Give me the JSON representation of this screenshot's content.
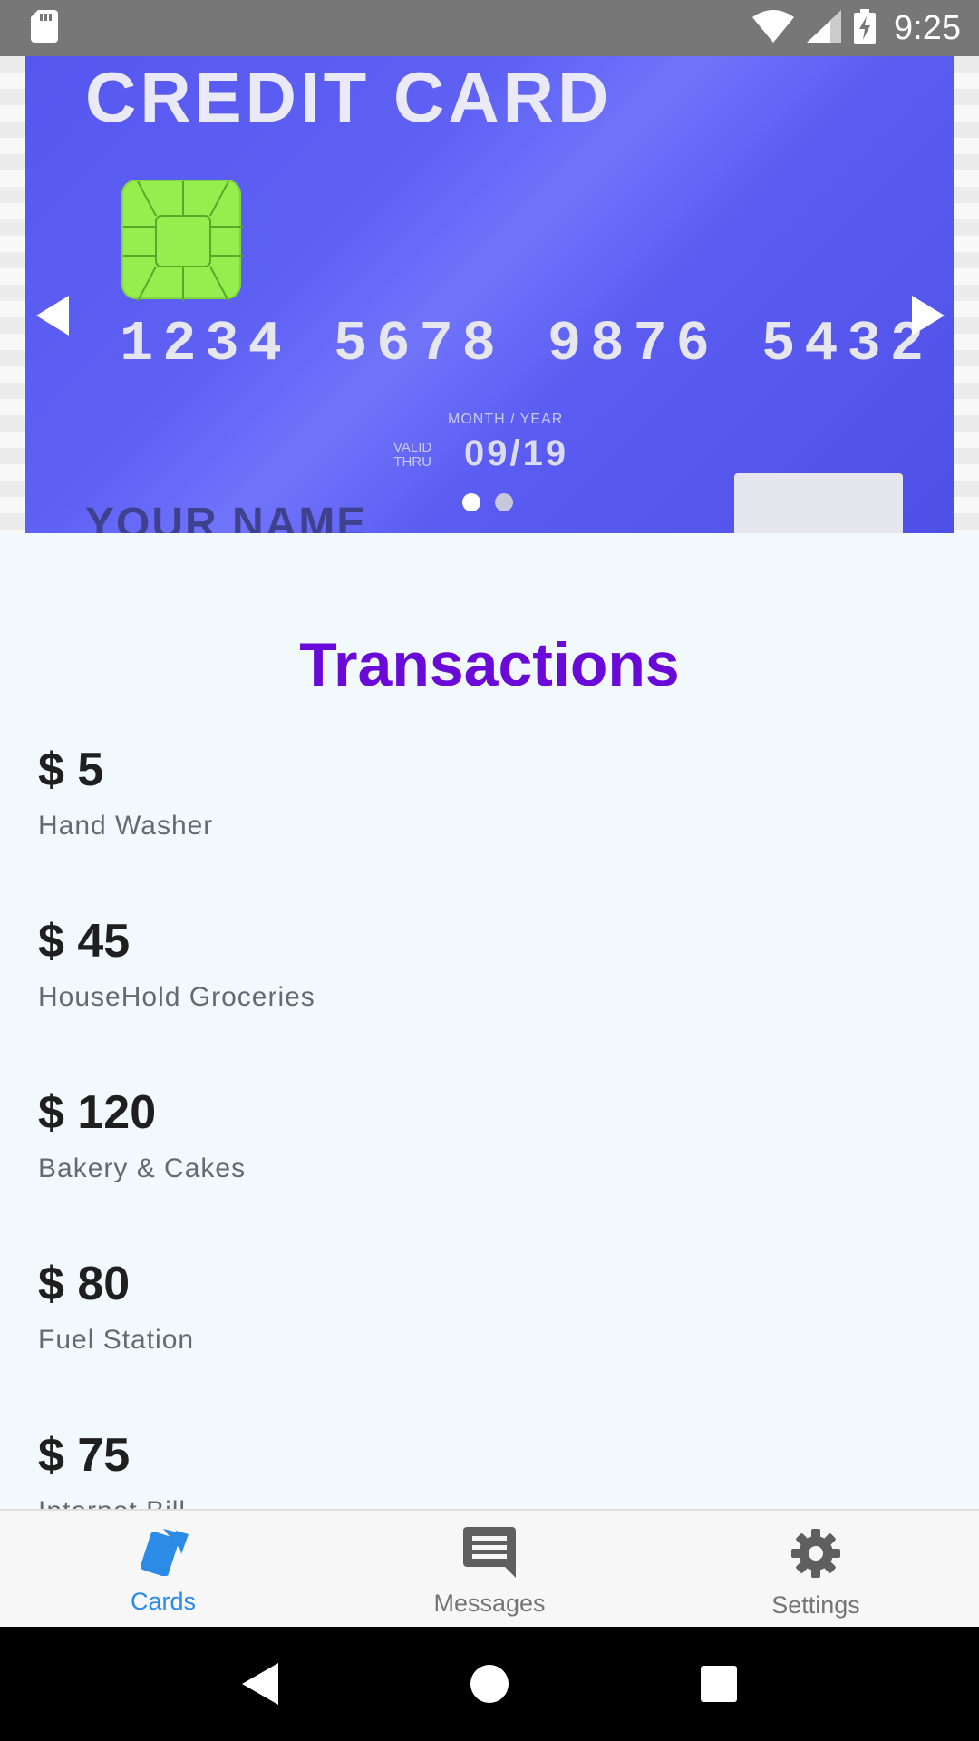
{
  "status_bar": {
    "time": "9:25",
    "icons": [
      "sd-card-icon",
      "wifi-icon",
      "signal-icon",
      "battery-charging-icon"
    ]
  },
  "carousel": {
    "card": {
      "title": "CREDIT CARD",
      "number": "1234 5678 9876 5432",
      "month_year_label": "MONTH / YEAR",
      "valid_line1": "VALID",
      "valid_line2": "THRU",
      "expiry": "09/19",
      "name": "YOUR NAME"
    },
    "page_count": 2,
    "active_page": 1
  },
  "transactions": {
    "title": "Transactions",
    "items": [
      {
        "amount": "$ 5",
        "label": "Hand Washer"
      },
      {
        "amount": "$ 45",
        "label": "HouseHold Groceries"
      },
      {
        "amount": "$ 120",
        "label": "Bakery & Cakes"
      },
      {
        "amount": "$ 80",
        "label": "Fuel Station"
      },
      {
        "amount": "$ 75",
        "label": "Internet Bill"
      }
    ]
  },
  "bottom_nav": {
    "items": [
      {
        "label": "Cards",
        "icon": "cards-icon",
        "active": true
      },
      {
        "label": "Messages",
        "icon": "message-icon",
        "active": false
      },
      {
        "label": "Settings",
        "icon": "gear-icon",
        "active": false
      }
    ]
  },
  "colors": {
    "accent": "#2b8be6",
    "title": "#6a0ad8",
    "card": "#5f61f4",
    "chip": "#94ef4e"
  }
}
